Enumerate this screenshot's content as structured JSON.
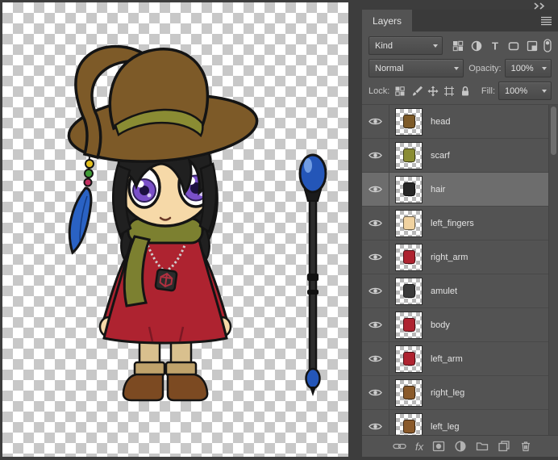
{
  "colors": {
    "window_bg": "#3d3d3d",
    "panel_bg": "#535353",
    "tabstrip_bg": "#3a3a3a",
    "control_border": "#393939",
    "row_divider": "#484848",
    "selected_row": "#6d6d6d",
    "text": "#e2e2e2",
    "label": "#c8c8c8",
    "icon": "#c6c6c6",
    "checker": "#c8c8c8",
    "outline": "#141414",
    "hat": "#7d5a28",
    "hat_band": "#8a8c33",
    "hair": "#202020",
    "skin": "#f6d9a8",
    "iris": "#7a50c8",
    "dress": "#ae2330",
    "scarf": "#7c8030",
    "legs": "#d9c08e",
    "cuff": "#bfa26b",
    "boots": "#7c4a22",
    "orb": "#2456b8",
    "feather": "#2a62c4"
  },
  "panel": {
    "tab_label": "Layers",
    "filter": {
      "kind_label": "Kind",
      "type_icon_glyph": "T"
    },
    "blend": {
      "mode_value": "Normal",
      "opacity_label": "Opacity:",
      "opacity_value": "100%"
    },
    "lock": {
      "label": "Lock:",
      "fill_label": "Fill:",
      "fill_value": "100%"
    },
    "layers": [
      {
        "name": "head",
        "visible": true,
        "selected": false,
        "thumb_color": "#7d5a28"
      },
      {
        "name": "scarf",
        "visible": true,
        "selected": false,
        "thumb_color": "#8a8c33"
      },
      {
        "name": "hair",
        "visible": true,
        "selected": true,
        "thumb_color": "#262626"
      },
      {
        "name": "left_fingers",
        "visible": true,
        "selected": false,
        "thumb_color": "#f0d2a0"
      },
      {
        "name": "right_arm",
        "visible": true,
        "selected": false,
        "thumb_color": "#ae2330"
      },
      {
        "name": "amulet",
        "visible": true,
        "selected": false,
        "thumb_color": "#3a3a3a"
      },
      {
        "name": "body",
        "visible": true,
        "selected": false,
        "thumb_color": "#ae2330"
      },
      {
        "name": "left_arm",
        "visible": true,
        "selected": false,
        "thumb_color": "#ae2330"
      },
      {
        "name": "right_leg",
        "visible": true,
        "selected": false,
        "thumb_color": "#8a5a2b"
      },
      {
        "name": "left_leg",
        "visible": true,
        "selected": false,
        "thumb_color": "#8a5a2b"
      }
    ],
    "bottom": {
      "fx_label": "fx"
    }
  }
}
